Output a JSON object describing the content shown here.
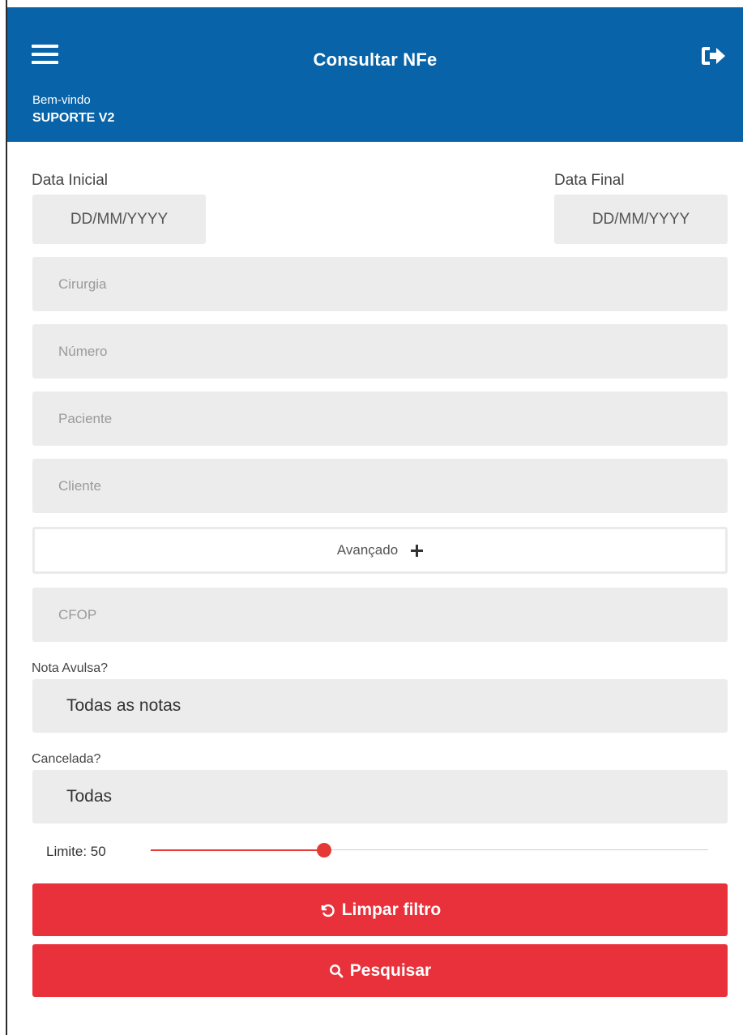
{
  "header": {
    "title": "Consultar NFe",
    "welcome": "Bem-vindo",
    "username": "SUPORTE V2",
    "menu_icon": "menu-icon",
    "logout_icon": "logout-icon",
    "color": "#0863a8"
  },
  "filters": {
    "start_date_label": "Data Inicial",
    "start_date_placeholder": "DD/MM/YYYY",
    "end_date_label": "Data Final",
    "end_date_placeholder": "DD/MM/YYYY",
    "surgery_placeholder": "Cirurgia",
    "number_placeholder": "Número",
    "patient_placeholder": "Paciente",
    "client_placeholder": "Cliente",
    "advanced_label": "Avançado",
    "cfop_placeholder": "CFOP",
    "nota_avulsa_label": "Nota Avulsa?",
    "nota_avulsa_value": "Todas as notas",
    "cancelada_label": "Cancelada?",
    "cancelada_value": "Todas",
    "limit_label": "Limite: 50",
    "limit_value": 50,
    "limit_fraction": 0.31
  },
  "actions": {
    "clear_label": "Limpar filtro",
    "search_label": "Pesquisar",
    "button_color": "#e8313a"
  }
}
